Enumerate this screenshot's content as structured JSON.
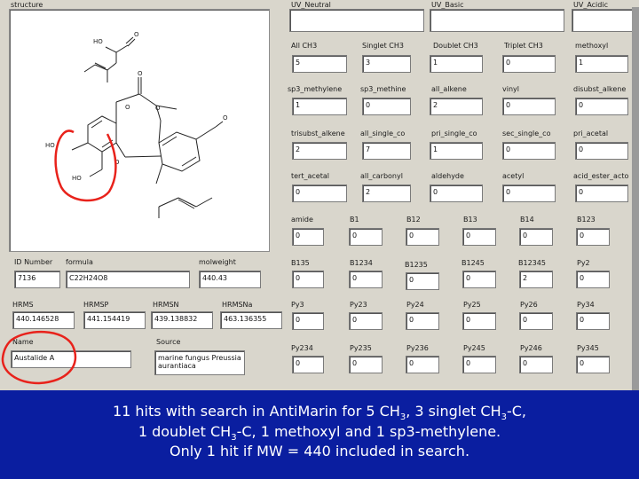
{
  "structure": {
    "label": "structure",
    "atoms": {
      "ho_top": "HO",
      "o_top": "O",
      "o_mid": "O",
      "o_right": "O",
      "o_ester": "O",
      "ho_left": "HO",
      "ho_bottom": "HO",
      "o_ring": "O",
      "o_ring2": "O"
    }
  },
  "uv": {
    "neutral": "UV_Neutral",
    "basic": "UV_Basic",
    "acidic": "UV_Acidic"
  },
  "grid": [
    [
      {
        "label": "All CH3",
        "value": "5"
      },
      {
        "label": "Singlet CH3",
        "value": "3"
      },
      {
        "label": "Doublet CH3",
        "value": "1"
      },
      {
        "label": "Triplet CH3",
        "value": "0"
      },
      {
        "label": "methoxyl",
        "value": "1"
      }
    ],
    [
      {
        "label": "sp3_methylene",
        "value": "1"
      },
      {
        "label": "sp3_methine",
        "value": "0"
      },
      {
        "label": "all_alkene",
        "value": "2"
      },
      {
        "label": "vinyl",
        "value": "0"
      },
      {
        "label": "disubst_alkene",
        "value": "0"
      }
    ],
    [
      {
        "label": "trisubst_alkene",
        "value": "2"
      },
      {
        "label": "all_single_co",
        "value": "7"
      },
      {
        "label": "pri_single_co",
        "value": "1"
      },
      {
        "label": "sec_single_co",
        "value": "0"
      },
      {
        "label": "pri_acetal",
        "value": "0"
      }
    ],
    [
      {
        "label": "tert_acetal",
        "value": "0"
      },
      {
        "label": "all_carbonyl",
        "value": "2"
      },
      {
        "label": "aldehyde",
        "value": "0"
      },
      {
        "label": "acetyl",
        "value": "0"
      },
      {
        "label": "acid_ester_acto",
        "value": "0"
      }
    ],
    [
      {
        "label": "amide",
        "value": "0"
      },
      {
        "label": "B1",
        "value": "0"
      },
      {
        "label": "B12",
        "value": "0"
      },
      {
        "label": "B13",
        "value": "0"
      },
      {
        "label": "B14",
        "value": "0"
      },
      {
        "label": "B123",
        "value": "0"
      }
    ],
    [
      {
        "label": "B135",
        "value": "0"
      },
      {
        "label": "B1234",
        "value": "0"
      },
      {
        "label": "B1235",
        "value": "0"
      },
      {
        "label": "B1245",
        "value": "0"
      },
      {
        "label": "B12345",
        "value": "2"
      },
      {
        "label": "Py2",
        "value": "0"
      }
    ],
    [
      {
        "label": "Py3",
        "value": "0"
      },
      {
        "label": "Py23",
        "value": "0"
      },
      {
        "label": "Py24",
        "value": "0"
      },
      {
        "label": "Py25",
        "value": "0"
      },
      {
        "label": "Py26",
        "value": "0"
      },
      {
        "label": "Py34",
        "value": "0"
      }
    ],
    [
      {
        "label": "Py234",
        "value": "0"
      },
      {
        "label": "Py235",
        "value": "0"
      },
      {
        "label": "Py236",
        "value": "0"
      },
      {
        "label": "Py245",
        "value": "0"
      },
      {
        "label": "Py246",
        "value": "0"
      },
      {
        "label": "Py345",
        "value": "0"
      }
    ]
  ],
  "info": {
    "id_label": "ID Number",
    "id_value": "7136",
    "formula_label": "formula",
    "formula_value": "C22H24O8",
    "mw_label": "molweight",
    "mw_value": "440.43",
    "hrms_label": "HRMS",
    "hrms_value": "440.146528",
    "hrmsp_label": "HRMSP",
    "hrmsp_value": "441.154419",
    "hrmsn_label": "HRMSN",
    "hrmsn_value": "439.138832",
    "hrmsna_label": "HRMSNa",
    "hrmsna_value": "463.136355",
    "name_label": "Name",
    "name_value": "Austalide A",
    "source_label": "Source",
    "source_value": "marine fungus Preussia",
    "source_value2": "aurantiaca"
  },
  "caption": {
    "line1_a": "11 hits with search in AntiMarin for 5 CH",
    "line1_sub1": "3",
    "line1_b": ", 3 singlet CH",
    "line1_sub2": "3",
    "line1_c": "-C,",
    "line2_a": "1 doublet CH",
    "line2_sub": "3",
    "line2_b": "-C, 1 methoxyl and 1 sp3-methylene.",
    "line3": "Only 1 hit if MW = 440 included in search."
  },
  "colors": {
    "panel": "#d9d6cc",
    "caption_bg": "#0a1ea0",
    "highlight": "#e8221b"
  }
}
